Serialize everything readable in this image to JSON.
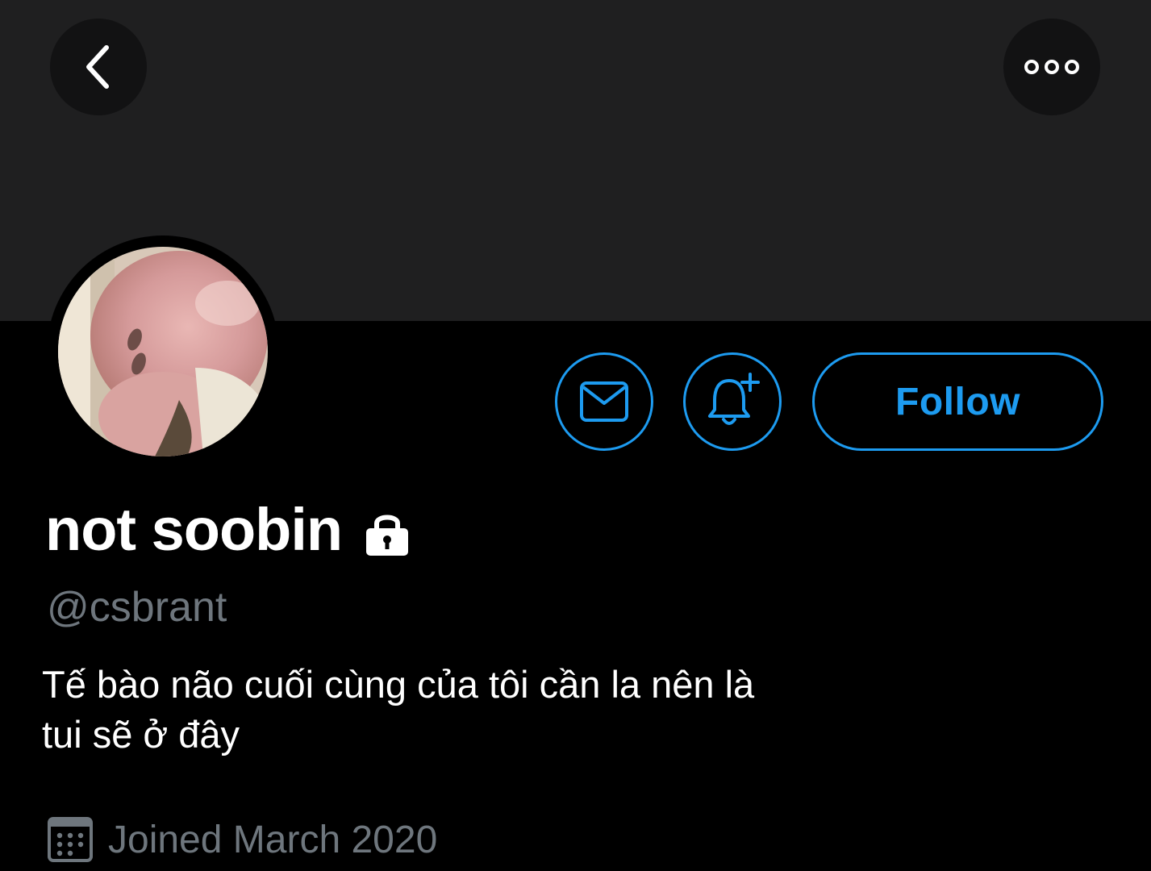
{
  "profile": {
    "display_name": "not soobin",
    "handle": "@csbrant",
    "bio": "Tế bào não cuối cùng của tôi cần la nên là\ntui sẽ ở đây",
    "joined": "Joined March 2020",
    "protected": true
  },
  "actions": {
    "follow_label": "Follow"
  },
  "icons": {
    "back": "chevron-left-icon",
    "more": "more-horizontal-icon",
    "message": "envelope-icon",
    "notify": "bell-plus-icon",
    "lock": "lock-icon",
    "calendar": "calendar-icon"
  },
  "colors": {
    "accent": "#1d9bf0",
    "banner": "#1f1f20",
    "background": "#000000",
    "secondary_text": "#6e767d"
  }
}
